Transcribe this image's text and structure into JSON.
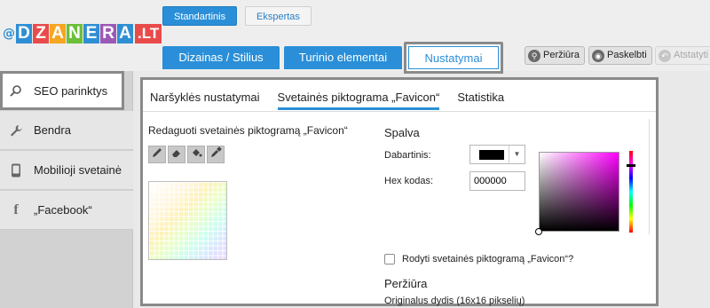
{
  "logo": {
    "at": "@",
    "letters": [
      {
        "ch": "D",
        "color": "#2f8fd4"
      },
      {
        "ch": "Z",
        "color": "#e94b4b"
      },
      {
        "ch": "A",
        "color": "#f5a623"
      },
      {
        "ch": "N",
        "color": "#6cbf3a"
      },
      {
        "ch": "E",
        "color": "#2f8fd4"
      },
      {
        "ch": "R",
        "color": "#9b59b6"
      },
      {
        "ch": "A",
        "color": "#2f8fd4"
      }
    ],
    "suffix": ".LT"
  },
  "mode": {
    "standard": "Standartinis",
    "expert": "Ekspertas"
  },
  "tabs": {
    "design": "Dizainas / Stilius",
    "content": "Turinio elementai",
    "settings": "Nustatymai"
  },
  "toolbar": {
    "preview": "Peržiūra",
    "publish": "Paskelbti",
    "revert": "Atstatyti"
  },
  "sidebar": {
    "seo": "SEO parinktys",
    "general": "Bendra",
    "mobile": "Mobilioji svetainė",
    "facebook": "„Facebook“"
  },
  "subtabs": {
    "browser": "Naršyklės nustatymai",
    "favicon": "Svetainės piktograma „Favicon“",
    "stats": "Statistika"
  },
  "editor": {
    "title": "Redaguoti svetainės piktogramą „Favicon“",
    "tools": [
      "pencil-icon",
      "eraser-icon",
      "fill-icon",
      "eyedropper-icon"
    ]
  },
  "color": {
    "heading": "Spalva",
    "current_label": "Dabartinis:",
    "current_value": "#000000",
    "hex_label": "Hex kodas:",
    "hex_value": "000000"
  },
  "show_favicon_label": "Rodyti svetainės piktogramą „Favicon“?",
  "preview": {
    "heading": "Peržiūra",
    "original_size": "Originalus dydis (16x16 pikselių)"
  }
}
